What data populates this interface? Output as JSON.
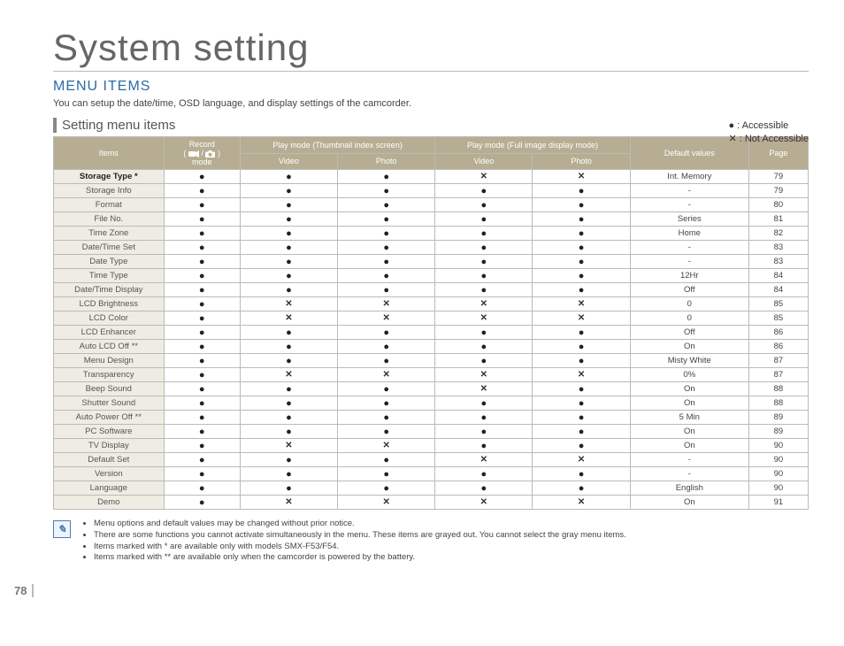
{
  "page_number": "78",
  "title": "System setting",
  "section_heading": "MENU ITEMS",
  "intro": "You can setup the date/time, OSD language, and display settings of the camcorder.",
  "legend": {
    "accessible": "● : Accessible",
    "not_accessible": "✕ : Not Accessible"
  },
  "sub_heading": "Setting menu items",
  "headers": {
    "items": "Items",
    "record_top": "Record",
    "record_bottom": "mode",
    "record_paren_open": "(",
    "record_paren_slash": "/",
    "record_paren_close": ")",
    "play_thumb": "Play mode (Thumbnail index screen)",
    "play_full": "Play mode (Full image display mode)",
    "video": "Video",
    "photo": "Photo",
    "default_values": "Default values",
    "page": "Page"
  },
  "symbols": {
    "dot": "●",
    "cross": "✕"
  },
  "chart_data": {
    "type": "table",
    "columns": [
      "Items",
      "Record mode",
      "Play Thumb Video",
      "Play Thumb Photo",
      "Play Full Video",
      "Play Full Photo",
      "Default values",
      "Page"
    ],
    "rows": [
      {
        "name": "Storage Type *",
        "cells": [
          "dot",
          "dot",
          "dot",
          "cross",
          "cross"
        ],
        "default": "Int. Memory",
        "page": "79"
      },
      {
        "name": "Storage Info",
        "cells": [
          "dot",
          "dot",
          "dot",
          "dot",
          "dot"
        ],
        "default": "-",
        "page": "79"
      },
      {
        "name": "Format",
        "cells": [
          "dot",
          "dot",
          "dot",
          "dot",
          "dot"
        ],
        "default": "-",
        "page": "80"
      },
      {
        "name": "File No.",
        "cells": [
          "dot",
          "dot",
          "dot",
          "dot",
          "dot"
        ],
        "default": "Series",
        "page": "81"
      },
      {
        "name": "Time Zone",
        "cells": [
          "dot",
          "dot",
          "dot",
          "dot",
          "dot"
        ],
        "default": "Home",
        "page": "82"
      },
      {
        "name": "Date/Time Set",
        "cells": [
          "dot",
          "dot",
          "dot",
          "dot",
          "dot"
        ],
        "default": "-",
        "page": "83"
      },
      {
        "name": "Date Type",
        "cells": [
          "dot",
          "dot",
          "dot",
          "dot",
          "dot"
        ],
        "default": "-",
        "page": "83"
      },
      {
        "name": "Time Type",
        "cells": [
          "dot",
          "dot",
          "dot",
          "dot",
          "dot"
        ],
        "default": "12Hr",
        "page": "84"
      },
      {
        "name": "Date/Time Display",
        "cells": [
          "dot",
          "dot",
          "dot",
          "dot",
          "dot"
        ],
        "default": "Off",
        "page": "84"
      },
      {
        "name": "LCD Brightness",
        "cells": [
          "dot",
          "cross",
          "cross",
          "cross",
          "cross"
        ],
        "default": "0",
        "page": "85"
      },
      {
        "name": "LCD Color",
        "cells": [
          "dot",
          "cross",
          "cross",
          "cross",
          "cross"
        ],
        "default": "0",
        "page": "85"
      },
      {
        "name": "LCD Enhancer",
        "cells": [
          "dot",
          "dot",
          "dot",
          "dot",
          "dot"
        ],
        "default": "Off",
        "page": "86"
      },
      {
        "name": "Auto LCD Off **",
        "cells": [
          "dot",
          "dot",
          "dot",
          "dot",
          "dot"
        ],
        "default": "On",
        "page": "86"
      },
      {
        "name": "Menu Design",
        "cells": [
          "dot",
          "dot",
          "dot",
          "dot",
          "dot"
        ],
        "default": "Misty White",
        "page": "87"
      },
      {
        "name": "Transparency",
        "cells": [
          "dot",
          "cross",
          "cross",
          "cross",
          "cross"
        ],
        "default": "0%",
        "page": "87"
      },
      {
        "name": "Beep Sound",
        "cells": [
          "dot",
          "dot",
          "dot",
          "cross",
          "dot"
        ],
        "default": "On",
        "page": "88"
      },
      {
        "name": "Shutter Sound",
        "cells": [
          "dot",
          "dot",
          "dot",
          "dot",
          "dot"
        ],
        "default": "On",
        "page": "88"
      },
      {
        "name": "Auto Power Off **",
        "cells": [
          "dot",
          "dot",
          "dot",
          "dot",
          "dot"
        ],
        "default": "5 Min",
        "page": "89"
      },
      {
        "name": "PC Software",
        "cells": [
          "dot",
          "dot",
          "dot",
          "dot",
          "dot"
        ],
        "default": "On",
        "page": "89"
      },
      {
        "name": "TV Display",
        "cells": [
          "dot",
          "cross",
          "cross",
          "dot",
          "dot"
        ],
        "default": "On",
        "page": "90"
      },
      {
        "name": "Default Set",
        "cells": [
          "dot",
          "dot",
          "dot",
          "cross",
          "cross"
        ],
        "default": "-",
        "page": "90"
      },
      {
        "name": "Version",
        "cells": [
          "dot",
          "dot",
          "dot",
          "dot",
          "dot"
        ],
        "default": "-",
        "page": "90"
      },
      {
        "name": "Language",
        "cells": [
          "dot",
          "dot",
          "dot",
          "dot",
          "dot"
        ],
        "default": "English",
        "page": "90"
      },
      {
        "name": "Demo",
        "cells": [
          "dot",
          "cross",
          "cross",
          "cross",
          "cross"
        ],
        "default": "On",
        "page": "91"
      }
    ]
  },
  "notes": [
    "Menu options and default values may be changed without prior notice.",
    "There are some functions you cannot activate simultaneously in the menu. These items are grayed out. You cannot select the gray menu items.",
    "Items marked with * are available only with models SMX-F53/F54.",
    "Items marked with ** are available only when the camcorder is powered by the battery."
  ]
}
